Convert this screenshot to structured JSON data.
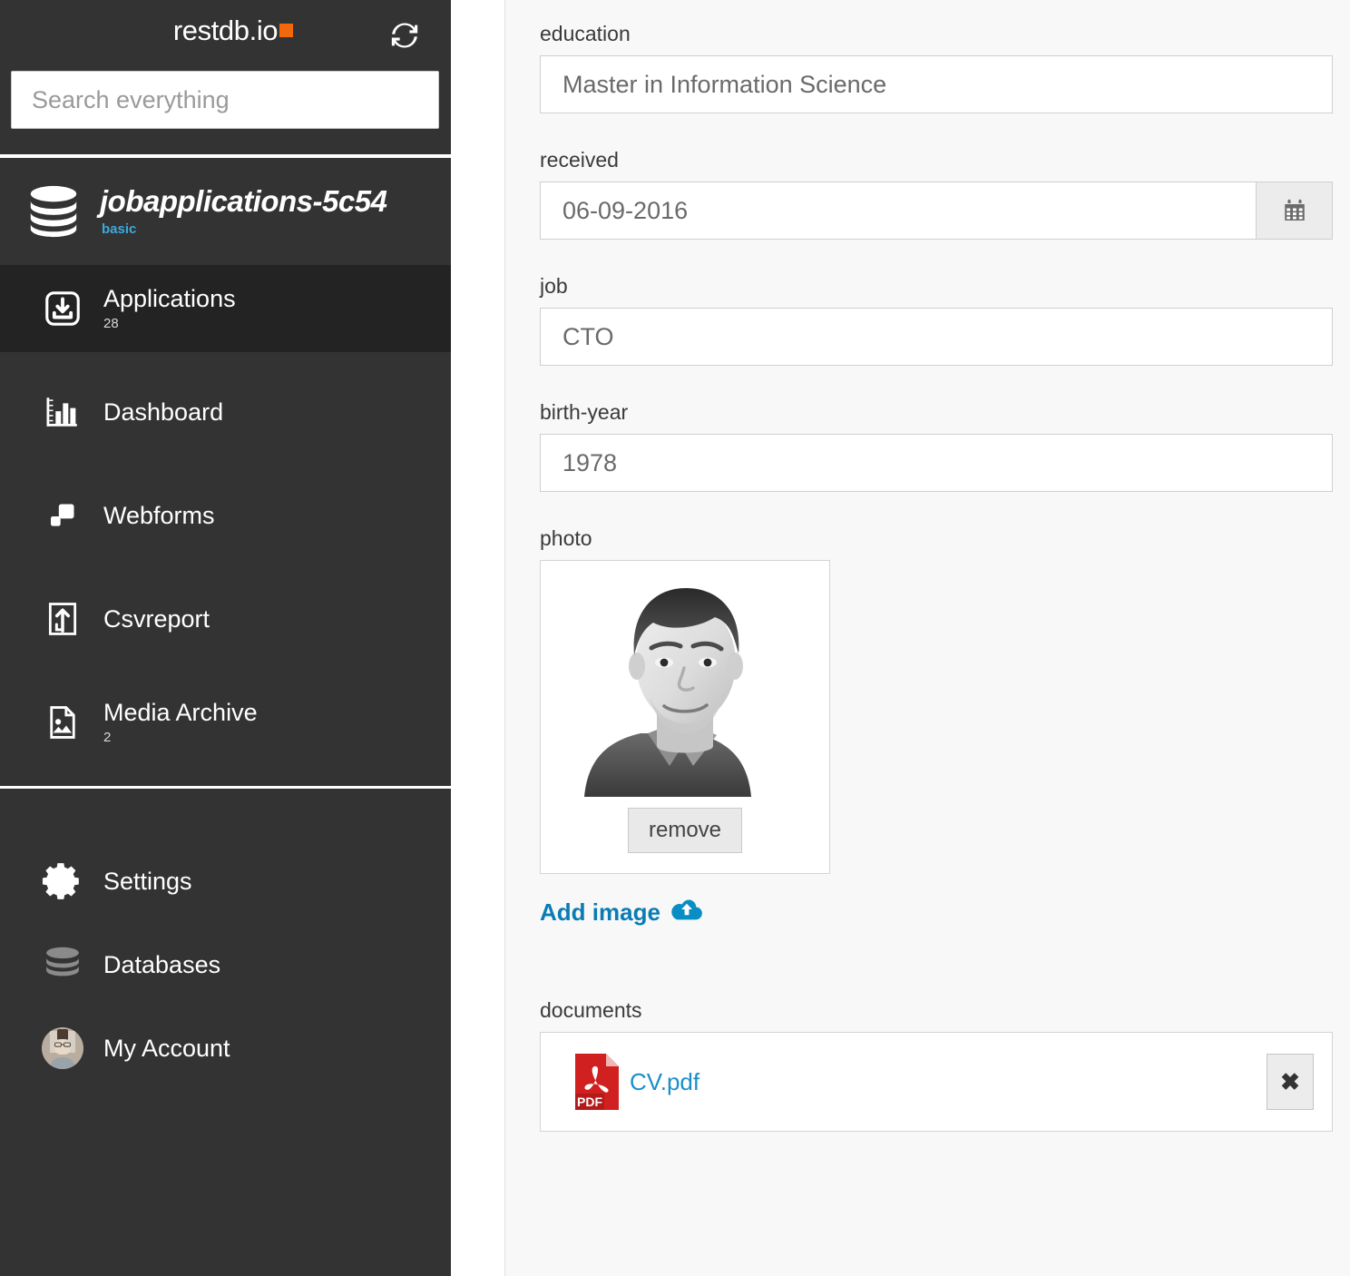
{
  "sidebar": {
    "logo_text": "restdb.io",
    "refresh_icon": "refresh-icon",
    "search": {
      "placeholder": "Search everything",
      "value": ""
    },
    "database": {
      "icon": "database-icon",
      "name": "jobapplications-5c54",
      "plan": "basic",
      "plan_color": "#3da9dd"
    },
    "collections": [
      {
        "icon": "inbox-download-icon",
        "label": "Applications",
        "count": "28",
        "active": true
      },
      {
        "icon": "bar-chart-icon",
        "label": "Dashboard",
        "count": "",
        "active": false
      },
      {
        "icon": "webforms-icon",
        "label": "Webforms",
        "count": "",
        "active": false
      },
      {
        "icon": "csv-upload-icon",
        "label": "Csvreport",
        "count": "",
        "active": false
      },
      {
        "icon": "image-file-icon",
        "label": "Media Archive",
        "count": "2",
        "active": false
      }
    ],
    "bottom_items": [
      {
        "icon": "gear-icon",
        "label": "Settings"
      },
      {
        "icon": "database-stack-icon",
        "label": "Databases"
      },
      {
        "icon": "avatar-icon",
        "label": "My Account"
      }
    ]
  },
  "form": {
    "fields": [
      {
        "label": "education",
        "value": "Master in Information Science"
      },
      {
        "label": "received",
        "value": "06-09-2016"
      },
      {
        "label": "job",
        "value": "CTO"
      },
      {
        "label": "birth-year",
        "value": "1978"
      }
    ],
    "education": {
      "label": "education",
      "value": "Master in Information Science"
    },
    "received": {
      "label": "received",
      "value": "06-09-2016",
      "calendar_icon": "calendar-icon"
    },
    "job": {
      "label": "job",
      "value": "CTO"
    },
    "birth_year": {
      "label": "birth-year",
      "value": "1978"
    },
    "photo": {
      "label": "photo",
      "remove_label": "remove",
      "add_label": "Add image",
      "add_icon": "cloud-upload-icon",
      "add_link_color": "#0a7cb4"
    },
    "documents": {
      "label": "documents",
      "items": [
        {
          "icon": "pdf-file-icon",
          "name": "CV.pdf",
          "delete_label": "✖"
        }
      ]
    }
  },
  "colors": {
    "sidebar_bg": "#333333",
    "sidebar_active_bg": "#232323",
    "accent_orange": "#f2690d",
    "accent_blue": "#3da9dd",
    "link_blue": "#0a7cb4",
    "content_bg": "#f8f8f8"
  }
}
